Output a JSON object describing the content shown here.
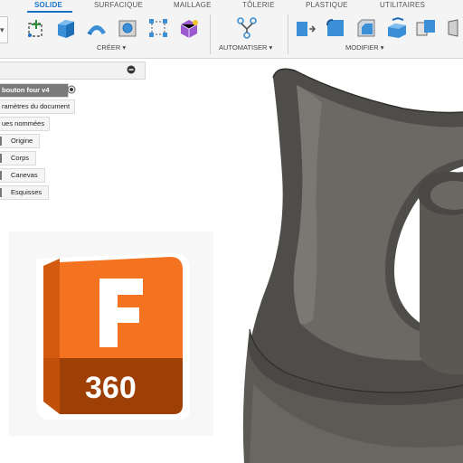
{
  "toolbar": {
    "tabs": [
      {
        "label": "SOLIDE",
        "active": true
      },
      {
        "label": "SURFACIQUE",
        "active": false
      },
      {
        "label": "MAILLAGE",
        "active": false
      },
      {
        "label": "TÔLERIE",
        "active": false
      },
      {
        "label": "PLASTIQUE",
        "active": false
      },
      {
        "label": "UTILITAIRES",
        "active": false
      }
    ],
    "groups": {
      "create": "CRÉER ▾",
      "automate": "AUTOMATISER ▾",
      "modify": "MODIFIER ▾"
    },
    "left_dropdown": "▾",
    "accent_color": "#1a73c9"
  },
  "browser": {
    "document_name": "bouton four v4",
    "items": [
      {
        "label": "ramètres du document"
      },
      {
        "label": "ues nommées"
      },
      {
        "label": "Origine"
      },
      {
        "label": "Corps"
      },
      {
        "label": "Canevas"
      },
      {
        "label": "Esquisses"
      }
    ]
  },
  "logo": {
    "letter": "F",
    "number": "360",
    "colors": {
      "orange": "#f37321",
      "dark_orange": "#d35b10",
      "brown": "#9e3f06",
      "fold": "#b84c0c"
    }
  },
  "viewport": {
    "model_color": "#5e5c57",
    "background": "#ffffff"
  }
}
